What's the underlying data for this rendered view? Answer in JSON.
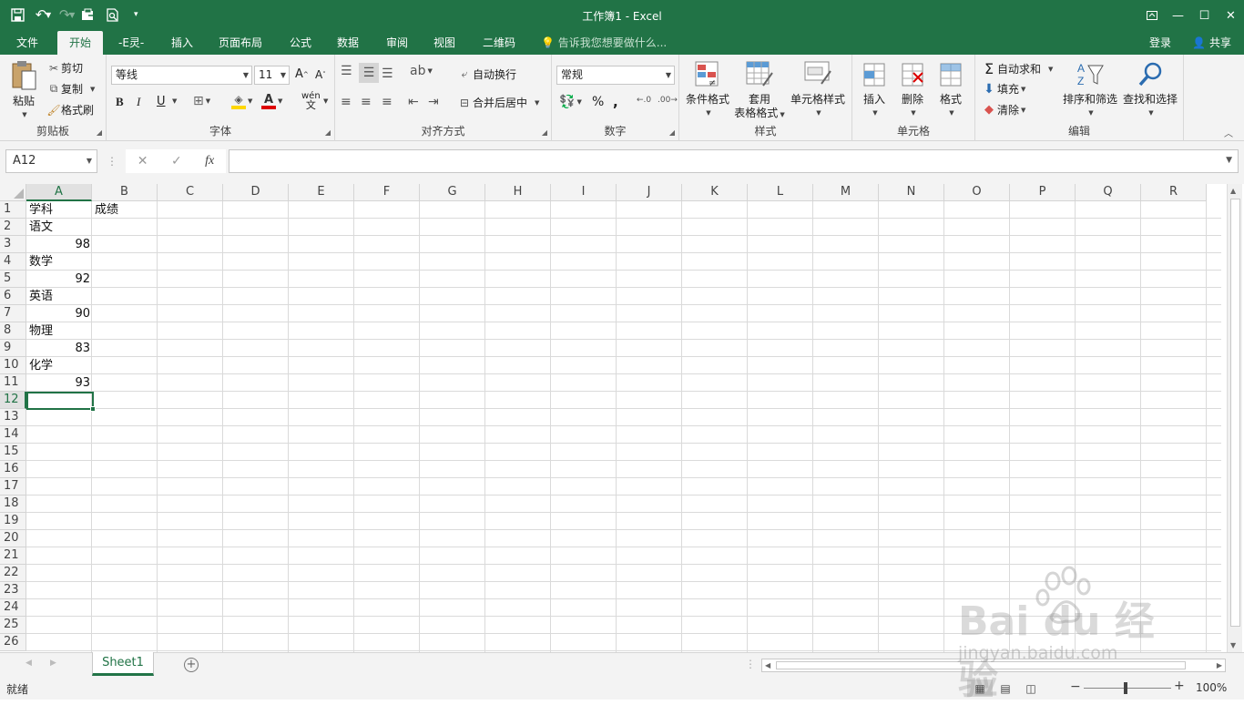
{
  "title": "工作簿1 - Excel",
  "tabs": [
    {
      "label": "文件"
    },
    {
      "label": "开始"
    },
    {
      "label": "-E灵-"
    },
    {
      "label": "插入"
    },
    {
      "label": "页面布局"
    },
    {
      "label": "公式"
    },
    {
      "label": "数据"
    },
    {
      "label": "审阅"
    },
    {
      "label": "视图"
    },
    {
      "label": "二维码"
    }
  ],
  "tell_me": "告诉我您想要做什么...",
  "login": "登录",
  "share": "共享",
  "ribbon": {
    "clipboard": {
      "label": "剪贴板",
      "paste": "粘贴",
      "cut": "剪切",
      "copy": "复制",
      "format_painter": "格式刷"
    },
    "font": {
      "label": "字体",
      "name": "等线",
      "size": "11",
      "bold": "B",
      "italic": "I",
      "underline": "U"
    },
    "alignment": {
      "label": "对齐方式",
      "wrap": "自动换行",
      "merge": "合并后居中"
    },
    "number": {
      "label": "数字",
      "format": "常规"
    },
    "styles": {
      "label": "样式",
      "conditional": "条件格式",
      "table_line1": "套用",
      "table_line2": "表格格式",
      "cell_styles": "单元格样式"
    },
    "cells": {
      "label": "单元格",
      "insert": "插入",
      "delete": "删除",
      "format": "格式"
    },
    "editing": {
      "label": "编辑",
      "autosum": "自动求和",
      "fill": "填充",
      "clear": "清除",
      "sort": "排序和筛选",
      "find": "查找和选择"
    }
  },
  "name_box": "A12",
  "columns": [
    "A",
    "B",
    "C",
    "D",
    "E",
    "F",
    "G",
    "H",
    "I",
    "J",
    "K",
    "L",
    "M",
    "N",
    "O",
    "P",
    "Q",
    "R"
  ],
  "rows": [
    "1",
    "2",
    "3",
    "4",
    "5",
    "6",
    "7",
    "8",
    "9",
    "10",
    "11",
    "12",
    "13",
    "14",
    "15",
    "16",
    "17",
    "18",
    "19",
    "20",
    "21",
    "22",
    "23",
    "24",
    "25",
    "26"
  ],
  "cells": {
    "A1": "学科",
    "B1": "成绩",
    "A2": "语文",
    "A3": "98",
    "A4": "数学",
    "A5": "92",
    "A6": "英语",
    "A7": "90",
    "A8": "物理",
    "A9": "83",
    "A10": "化学",
    "A11": "93"
  },
  "sheet_tab": "Sheet1",
  "status": "就绪",
  "zoom": "100%",
  "watermark": {
    "brand": "Bai du 经验",
    "url": "jingyan.baidu.com"
  }
}
